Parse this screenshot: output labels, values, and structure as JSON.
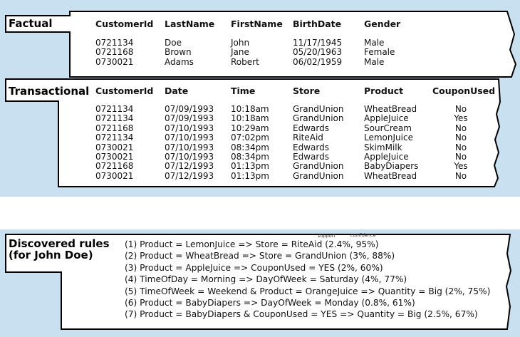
{
  "factual": {
    "title": "Factual",
    "headers": [
      "CustomerId",
      "LastName",
      "FirstName",
      "BirthDate",
      "Gender"
    ],
    "rows": [
      [
        "0721134",
        "Doe",
        "John",
        "11/17/1945",
        "Male"
      ],
      [
        "0721168",
        "Brown",
        "Jane",
        "05/20/1963",
        "Female"
      ],
      [
        "0730021",
        "Adams",
        "Robert",
        "06/02/1959",
        "Male"
      ]
    ]
  },
  "transactional": {
    "title": "Transactional",
    "headers": [
      "CustomerId",
      "Date",
      "Time",
      "Store",
      "Product",
      "CouponUsed"
    ],
    "rows": [
      [
        "0721134",
        "07/09/1993",
        "10:18am",
        "GrandUnion",
        "WheatBread",
        "No"
      ],
      [
        "0721134",
        "07/09/1993",
        "10:18am",
        "GrandUnion",
        "AppleJuice",
        "Yes"
      ],
      [
        "0721168",
        "07/10/1993",
        "10:29am",
        "Edwards",
        "SourCream",
        "No"
      ],
      [
        "0721134",
        "07/10/1993",
        "07:02pm",
        "RiteAid",
        "LemonJuice",
        "No"
      ],
      [
        "0730021",
        "07/10/1993",
        "08:34pm",
        "Edwards",
        "SkimMilk",
        "No"
      ],
      [
        "0730021",
        "07/10/1993",
        "08:34pm",
        "Edwards",
        "AppleJuice",
        "No"
      ],
      [
        "0721168",
        "07/12/1993",
        "01:13pm",
        "GrandUnion",
        "BabyDiapers",
        "Yes"
      ],
      [
        "0730021",
        "07/12/1993",
        "01:13pm",
        "GrandUnion",
        "WheatBread",
        "No"
      ]
    ]
  },
  "rules": {
    "title_line1": "Discovered rules",
    "title_line2": "(for John Doe)",
    "note_support": "support",
    "note_confidence": "confidence",
    "items": [
      "(1) Product = LemonJuice => Store = RiteAid (2.4%, 95%)",
      "(2) Product = WheatBread => Store = GrandUnion (3%, 88%)",
      "(3) Product = AppleJuice => CouponUsed = YES (2%, 60%)",
      "(4) TimeOfDay = Morning => DayOfWeek = Saturday (4%, 77%)",
      "(5) TimeOfWeek = Weekend & Product = OrangeJuice => Quantity = Big (2%, 75%)",
      "(6) Product = BabyDiapers => DayOfWeek = Monday (0.8%, 61%)",
      "(7) Product = BabyDiapers & CouponUsed = YES => Quantity = Big (2.5%, 67%)"
    ]
  },
  "colors": {
    "background": "#c8e0f0",
    "panel": "#ffffff",
    "border": "#000000",
    "divider": "#ffffff"
  }
}
